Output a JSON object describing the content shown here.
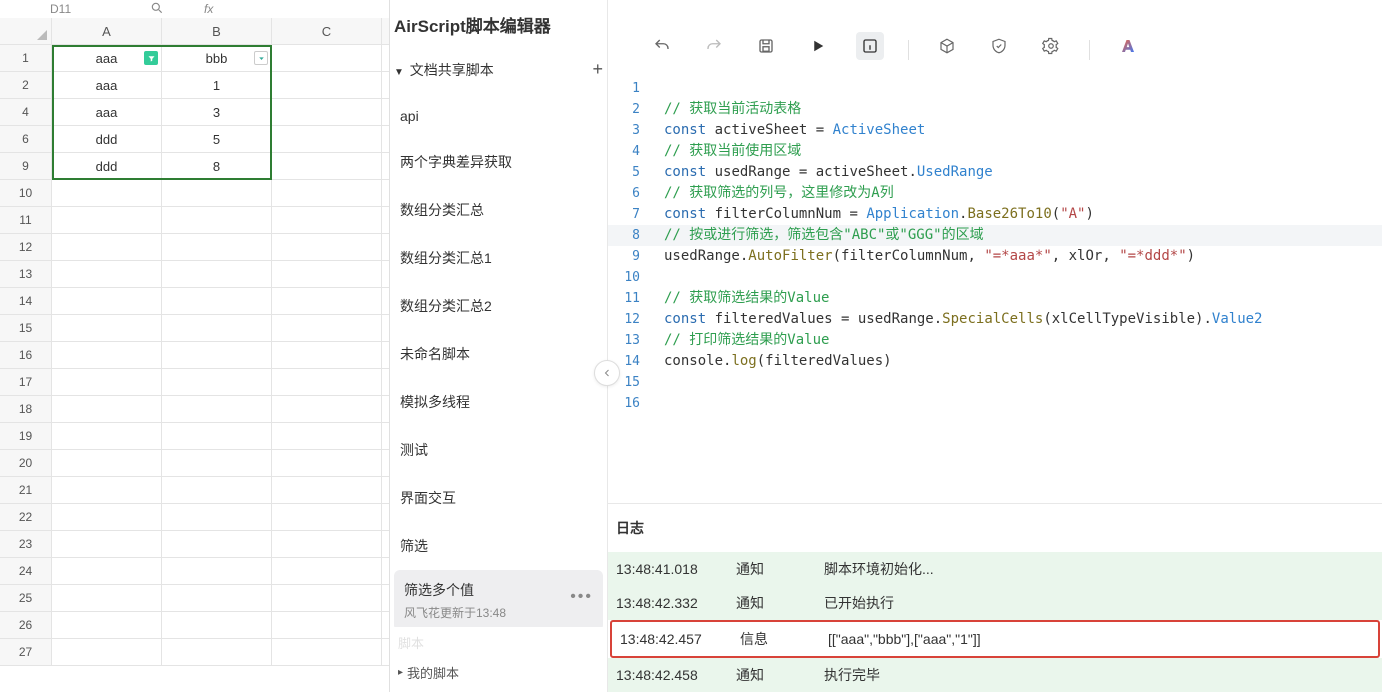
{
  "sheet": {
    "cell_ref": "D11",
    "fx_icon": "fx",
    "columns": [
      "A",
      "B",
      "C"
    ],
    "rows": [
      {
        "n": 1,
        "cells": [
          "aaa",
          "bbb",
          ""
        ],
        "filterA": true,
        "filterB": true
      },
      {
        "n": 2,
        "cells": [
          "aaa",
          "1",
          ""
        ]
      },
      {
        "n": 4,
        "cells": [
          "aaa",
          "3",
          ""
        ]
      },
      {
        "n": 6,
        "cells": [
          "ddd",
          "5",
          ""
        ]
      },
      {
        "n": 9,
        "cells": [
          "ddd",
          "8",
          ""
        ]
      },
      {
        "n": 10,
        "cells": [
          "",
          "",
          ""
        ]
      },
      {
        "n": 11,
        "cells": [
          "",
          "",
          ""
        ]
      },
      {
        "n": 12,
        "cells": [
          "",
          "",
          ""
        ]
      },
      {
        "n": 13,
        "cells": [
          "",
          "",
          ""
        ]
      },
      {
        "n": 14,
        "cells": [
          "",
          "",
          ""
        ]
      },
      {
        "n": 15,
        "cells": [
          "",
          "",
          ""
        ]
      },
      {
        "n": 16,
        "cells": [
          "",
          "",
          ""
        ]
      },
      {
        "n": 17,
        "cells": [
          "",
          "",
          ""
        ]
      },
      {
        "n": 18,
        "cells": [
          "",
          "",
          ""
        ]
      },
      {
        "n": 19,
        "cells": [
          "",
          "",
          ""
        ]
      },
      {
        "n": 20,
        "cells": [
          "",
          "",
          ""
        ]
      },
      {
        "n": 21,
        "cells": [
          "",
          "",
          ""
        ]
      },
      {
        "n": 22,
        "cells": [
          "",
          "",
          ""
        ]
      },
      {
        "n": 23,
        "cells": [
          "",
          "",
          ""
        ]
      },
      {
        "n": 24,
        "cells": [
          "",
          "",
          ""
        ]
      },
      {
        "n": 25,
        "cells": [
          "",
          "",
          ""
        ]
      },
      {
        "n": 26,
        "cells": [
          "",
          "",
          ""
        ]
      },
      {
        "n": 27,
        "cells": [
          "",
          "",
          ""
        ]
      }
    ]
  },
  "tree": {
    "editor_title": "AirScript脚本编辑器",
    "section_label": "文档共享脚本",
    "items": [
      {
        "label": "api"
      },
      {
        "label": "两个字典差异获取"
      },
      {
        "label": "数组分类汇总"
      },
      {
        "label": "数组分类汇总1"
      },
      {
        "label": "数组分类汇总2"
      },
      {
        "label": "未命名脚本"
      },
      {
        "label": "模拟多线程"
      },
      {
        "label": "测试"
      },
      {
        "label": "界面交互"
      },
      {
        "label": "筛选"
      },
      {
        "label": "筛选多个值",
        "sub": "风飞花更新于13:48",
        "selected": true
      }
    ],
    "truncated_item": "脚本",
    "footer": "我的脚本"
  },
  "code": {
    "lines": [
      {
        "n": 1,
        "tokens": []
      },
      {
        "n": 2,
        "tokens": [
          {
            "t": "comment",
            "v": "// 获取当前活动表格"
          }
        ]
      },
      {
        "n": 3,
        "tokens": [
          {
            "t": "keyword",
            "v": "const"
          },
          {
            "t": "plain",
            "v": " activeSheet = "
          },
          {
            "t": "prop",
            "v": "ActiveSheet"
          }
        ]
      },
      {
        "n": 4,
        "tokens": [
          {
            "t": "comment",
            "v": "// 获取当前使用区域"
          }
        ]
      },
      {
        "n": 5,
        "tokens": [
          {
            "t": "keyword",
            "v": "const"
          },
          {
            "t": "plain",
            "v": " usedRange = activeSheet."
          },
          {
            "t": "prop",
            "v": "UsedRange"
          }
        ]
      },
      {
        "n": 6,
        "tokens": [
          {
            "t": "comment",
            "v": "// 获取筛选的列号，这里修改为A列"
          }
        ]
      },
      {
        "n": 7,
        "tokens": [
          {
            "t": "keyword",
            "v": "const"
          },
          {
            "t": "plain",
            "v": " filterColumnNum = "
          },
          {
            "t": "prop",
            "v": "Application"
          },
          {
            "t": "plain",
            "v": "."
          },
          {
            "t": "func",
            "v": "Base26To10"
          },
          {
            "t": "plain",
            "v": "("
          },
          {
            "t": "string",
            "v": "\"A\""
          },
          {
            "t": "plain",
            "v": ")"
          }
        ]
      },
      {
        "n": 8,
        "hl": true,
        "tokens": [
          {
            "t": "comment",
            "v": "// 按或进行筛选，筛选包含\"ABC\"或\"GGG\"的区域"
          }
        ]
      },
      {
        "n": 9,
        "tokens": [
          {
            "t": "plain",
            "v": "usedRange."
          },
          {
            "t": "func",
            "v": "AutoFilter"
          },
          {
            "t": "plain",
            "v": "(filterColumnNum, "
          },
          {
            "t": "string",
            "v": "\"=*aaa*\""
          },
          {
            "t": "plain",
            "v": ", xlOr, "
          },
          {
            "t": "string",
            "v": "\"=*ddd*\""
          },
          {
            "t": "plain",
            "v": ")"
          }
        ]
      },
      {
        "n": 10,
        "tokens": []
      },
      {
        "n": 11,
        "tokens": [
          {
            "t": "comment",
            "v": "// 获取筛选结果的Value"
          }
        ]
      },
      {
        "n": 12,
        "tokens": [
          {
            "t": "keyword",
            "v": "const"
          },
          {
            "t": "plain",
            "v": " filteredValues = usedRange."
          },
          {
            "t": "func",
            "v": "SpecialCells"
          },
          {
            "t": "plain",
            "v": "(xlCellTypeVisible)."
          },
          {
            "t": "prop",
            "v": "Value2"
          }
        ]
      },
      {
        "n": 13,
        "tokens": [
          {
            "t": "comment",
            "v": "// 打印筛选结果的Value"
          }
        ]
      },
      {
        "n": 14,
        "tokens": [
          {
            "t": "plain",
            "v": "console."
          },
          {
            "t": "func",
            "v": "log"
          },
          {
            "t": "plain",
            "v": "(filteredValues)"
          }
        ]
      },
      {
        "n": 15,
        "tokens": []
      },
      {
        "n": 16,
        "tokens": []
      }
    ]
  },
  "log": {
    "title": "日志",
    "rows": [
      {
        "time": "13:48:41.018",
        "type": "通知",
        "msg": "脚本环境初始化...",
        "cls": "green"
      },
      {
        "time": "13:48:42.332",
        "type": "通知",
        "msg": "已开始执行",
        "cls": "green"
      },
      {
        "time": "13:48:42.457",
        "type": "信息",
        "msg": "[[\"aaa\",\"bbb\"],[\"aaa\",\"1\"]]",
        "highlight": true
      },
      {
        "time": "13:48:42.458",
        "type": "通知",
        "msg": "执行完毕",
        "cls": "green"
      }
    ]
  }
}
